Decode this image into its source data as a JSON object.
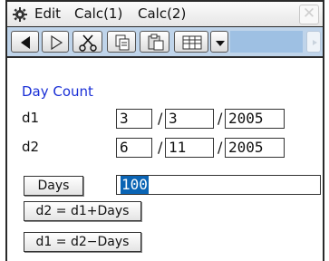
{
  "menubar": {
    "menu_label": "Edit",
    "tab1": "Calc(1)",
    "tab2": "Calc(2)"
  },
  "icons": [
    "settings-icon",
    "back-arrow-icon",
    "play-icon",
    "cut-icon",
    "copy-icon",
    "paste-icon",
    "grid-icon",
    "dropdown-icon",
    "close-icon"
  ],
  "panel": {
    "title": "Day Count",
    "d1": {
      "label": "d1",
      "day": "3",
      "month": "3",
      "year": "2005"
    },
    "d2": {
      "label": "d2",
      "day": "6",
      "month": "11",
      "year": "2005"
    },
    "separator": "/",
    "days_button": "Days",
    "days_value": "100",
    "btn_d2": "d2 = d1+Days",
    "btn_d1": "d1 = d2−Days"
  },
  "colors": {
    "title": "#1a2fd6",
    "toolbar_bg": "#bfd4ea",
    "selection": "#0a64b4"
  }
}
